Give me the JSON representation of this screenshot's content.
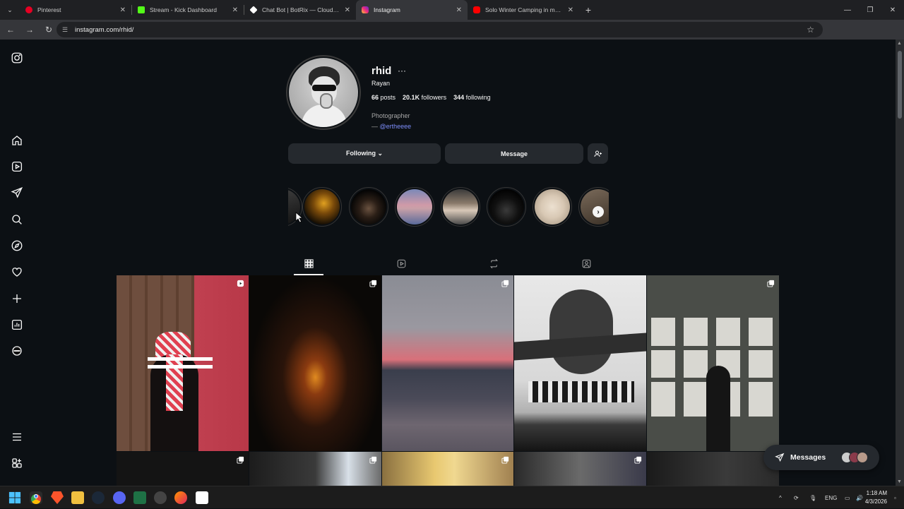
{
  "browser": {
    "tabs": [
      {
        "title": "Pinterest",
        "color": "#e60023",
        "active": false
      },
      {
        "title": "Stream - Kick Dashboard",
        "color": "#53fc18",
        "active": false
      },
      {
        "title": "Chat Bot | BotRix — Cloud Strea",
        "color": "#ffffff",
        "active": false
      },
      {
        "title": "Instagram",
        "color": "#e1306c",
        "active": true
      },
      {
        "title": "Solo Winter Camping in my Sup",
        "color": "#ff0000",
        "active": false
      }
    ],
    "url": "instagram.com/rhid/"
  },
  "profile": {
    "username": "rhid",
    "more": "···",
    "full_name": "Rayan",
    "stats": {
      "posts_count": "66",
      "posts_label": "posts",
      "followers_count": "20.1K",
      "followers_label": "followers",
      "following_count": "344",
      "following_label": "following"
    },
    "bio": "Photographer",
    "bio_prefix": "— ",
    "bio_link": "@ertheeee",
    "buttons": {
      "following": "Following ⌄",
      "message": "Message"
    }
  },
  "messages_pill": {
    "label": "Messages"
  },
  "taskbar": {
    "language": "ENG",
    "time": "1:18 AM",
    "date": "4/3/2026"
  },
  "colors": {
    "background": "#0c1014",
    "button": "#25292e",
    "link": "#7c8cf8"
  }
}
